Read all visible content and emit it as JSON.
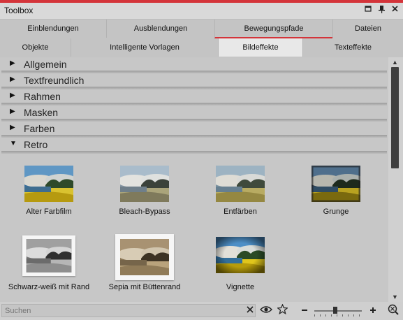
{
  "window": {
    "title": "Toolbox"
  },
  "title_icons": [
    "restore-icon",
    "pin-icon",
    "close-icon"
  ],
  "tabs_row1": [
    {
      "label": "Einblendungen"
    },
    {
      "label": "Ausblendungen"
    },
    {
      "label": "Bewegungspfade"
    },
    {
      "label": "Dateien"
    }
  ],
  "tabs_row2": [
    {
      "label": "Objekte"
    },
    {
      "label": "Intelligente Vorlagen"
    },
    {
      "label": "Bildeffekte"
    },
    {
      "label": "Texteffekte"
    }
  ],
  "active_tab": "Bildeffekte",
  "sections": [
    {
      "label": "Allgemein",
      "arrow": "▶",
      "expanded": false
    },
    {
      "label": "Textfreundlich",
      "arrow": "▶",
      "expanded": false
    },
    {
      "label": "Rahmen",
      "arrow": "▶",
      "expanded": false
    },
    {
      "label": "Masken",
      "arrow": "▶",
      "expanded": false
    },
    {
      "label": "Farben",
      "arrow": "▶",
      "expanded": false
    },
    {
      "label": "Retro",
      "arrow": "▼",
      "expanded": true
    }
  ],
  "effects": [
    {
      "label": "Alter Farbfilm",
      "style": "old-color"
    },
    {
      "label": "Bleach-Bypass",
      "style": "bleach"
    },
    {
      "label": "Entfärben",
      "style": "desat"
    },
    {
      "label": "Grunge",
      "style": "grunge"
    },
    {
      "label": "Schwarz-weiß mit Rand",
      "style": "bw-frame"
    },
    {
      "label": "Sepia mit Büttenrand",
      "style": "sepia-frame"
    },
    {
      "label": "Vignette",
      "style": "vignette"
    }
  ],
  "search": {
    "placeholder": "Suchen"
  },
  "colors": {
    "accent": "#d4343a"
  }
}
